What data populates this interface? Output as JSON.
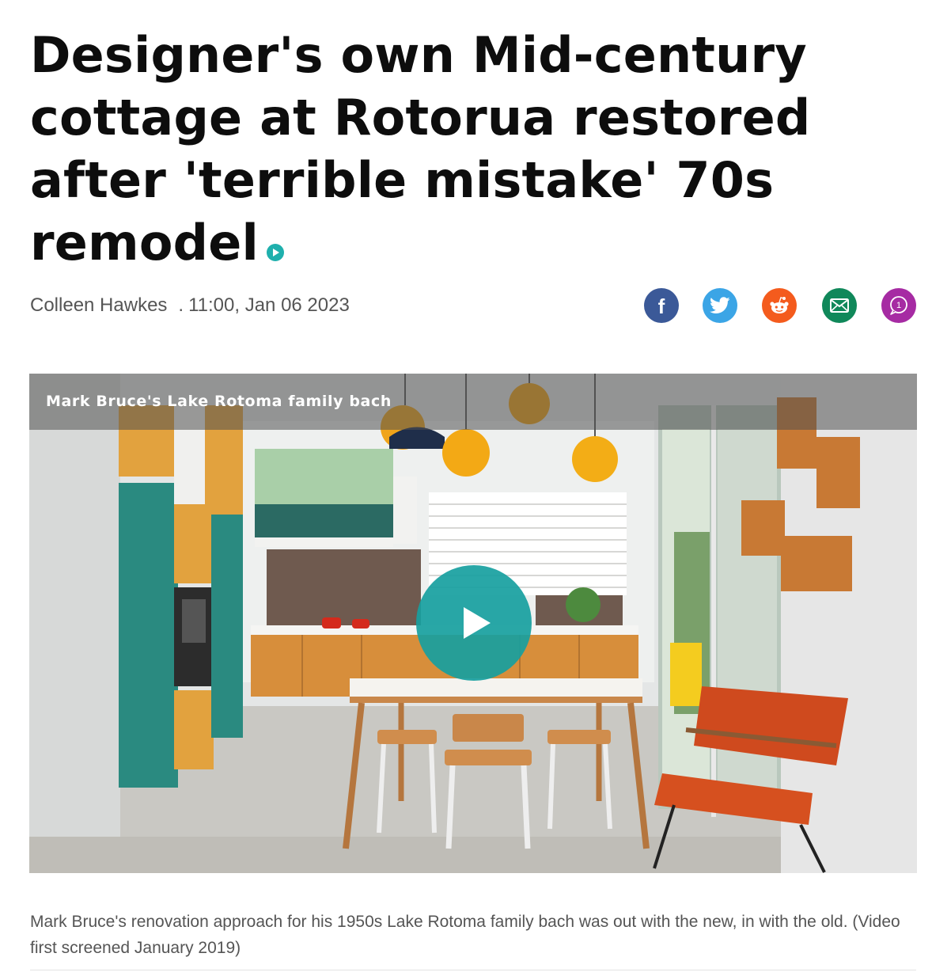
{
  "article": {
    "headline_lines": [
      "Designer's own Mid-century",
      "cottage at Rotorua restored",
      "after 'terrible mistake' 70s",
      "remodel"
    ],
    "author": "Colleen Hawkes",
    "separator": ".",
    "timestamp": "11:00, Jan 06 2023",
    "caption": "Mark Bruce's renovation approach for his 1950s Lake Rotoma family bach was out with the new, in with the old. (Video first screened January 2019)"
  },
  "share": {
    "buttons": [
      {
        "icon": "facebook-icon",
        "glyph": "f",
        "color": "#3b5998"
      },
      {
        "icon": "twitter-icon",
        "color": "#3ba5e6"
      },
      {
        "icon": "reddit-icon",
        "color": "#f45b1d"
      },
      {
        "icon": "email-icon",
        "color": "#10885a"
      },
      {
        "icon": "comments-icon",
        "color": "#a62ba3"
      }
    ],
    "comment_count": "1"
  },
  "video": {
    "title": "Mark Bruce's Lake Rotoma family bach",
    "accent_color": "#1fb0ad"
  }
}
